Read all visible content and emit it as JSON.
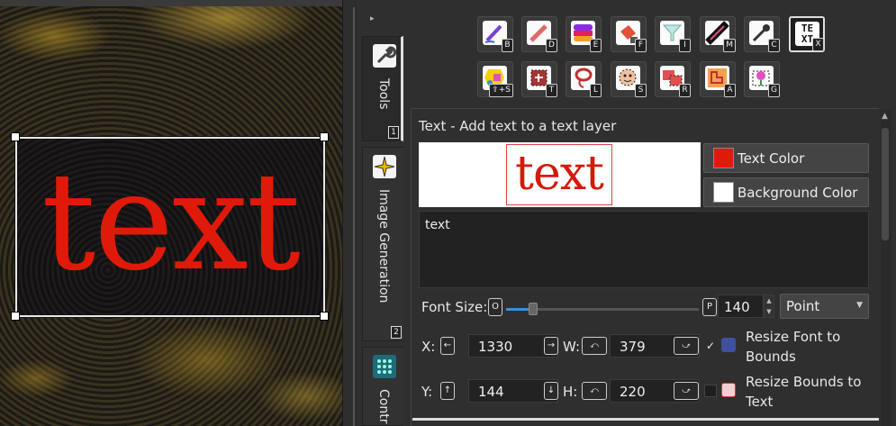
{
  "canvas": {
    "layer_text": "text"
  },
  "side_tabs": [
    {
      "label": "Tools",
      "badge": "1",
      "icon": "wrench-icon"
    },
    {
      "label": "Image Generation",
      "badge": "2",
      "icon": "sparkle-icon"
    },
    {
      "label": "Contr",
      "icon": "grid-icon"
    }
  ],
  "tools_row1": [
    {
      "name": "brush",
      "key": "B",
      "icon": "brush-icon"
    },
    {
      "name": "draw",
      "key": "D",
      "icon": "pencil-icon"
    },
    {
      "name": "eraser",
      "key": "E",
      "icon": "eraser-icon"
    },
    {
      "name": "fill",
      "key": "F",
      "icon": "bucket-fill-icon"
    },
    {
      "name": "filter",
      "key": "I",
      "icon": "filter-icon"
    },
    {
      "name": "smudge",
      "key": "M",
      "icon": "smudge-icon"
    },
    {
      "name": "color-pick",
      "key": "C",
      "icon": "eyedropper-icon"
    },
    {
      "name": "text",
      "key": "X",
      "icon": "text-tool-icon",
      "glyph": "TE XT"
    }
  ],
  "tools_row2": [
    {
      "name": "shape-selection",
      "key": "⇧+S",
      "icon": "shape-select-icon"
    },
    {
      "name": "transform",
      "key": "T",
      "icon": "transform-icon"
    },
    {
      "name": "lasso",
      "key": "L",
      "icon": "lasso-icon"
    },
    {
      "name": "smart-select",
      "key": "S",
      "icon": "face-select-icon"
    },
    {
      "name": "rect-select",
      "key": "R",
      "icon": "rect-select-icon"
    },
    {
      "name": "ai-select",
      "key": "A",
      "icon": "ai-select-icon"
    },
    {
      "name": "generate",
      "key": "G",
      "icon": "generate-icon"
    }
  ],
  "options": {
    "title": "Text - Add text to a text layer",
    "preview_text": "text",
    "text_color_label": "Text Color",
    "bg_color_label": "Background Color",
    "text_value": "text",
    "font_size_label": "Font Size:",
    "font_min_key": "O",
    "font_max_key": "P",
    "font_size_value": "140",
    "font_size_fraction": 0.14,
    "unit": "Point",
    "x_label": "X:",
    "x_value": "1330",
    "w_label": "W:",
    "w_value": "379",
    "y_label": "Y:",
    "y_value": "144",
    "h_label": "H:",
    "h_value": "220",
    "resize_font_label": "Resize Font to Bounds",
    "resize_bounds_label": "Resize Bounds to Text",
    "resize_font_checked": true,
    "resize_bounds_checked": false,
    "dec_glyph": "←",
    "inc_glyph": "→",
    "up_glyph": "↑",
    "down_glyph": "↓",
    "w_dec_glyph": "⤺",
    "w_inc_glyph": "⤻",
    "h_dec_glyph": "⤺",
    "h_inc_glyph": "⤻",
    "check_mark": "✓"
  },
  "colors": {
    "text_color": "#e01a0a",
    "background_color": "#ffffff",
    "accent": "#3d8fd6"
  }
}
